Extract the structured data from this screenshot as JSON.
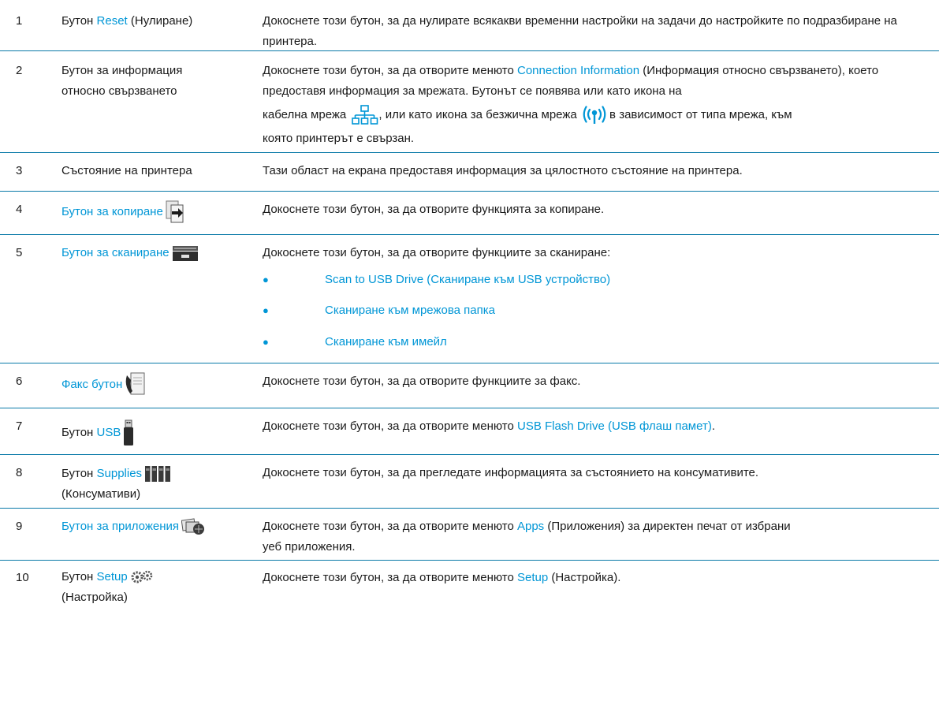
{
  "rows": [
    {
      "num": "1",
      "name": [
        "Бутон ",
        "Reset",
        " (Нулиране)"
      ],
      "desc": "Докоснете този бутон, за да нулирате всякакви временни настройки на задачи до настройките по подразбиране на принтера."
    },
    {
      "num": "2",
      "name": "Бутон за информация относно свързването",
      "desc_a": "Докоснете този бутон, за да отворите менюто ",
      "desc_link": "Connection Information",
      "desc_b": " (Информация относно свързването), което предоставя информация за мрежата. Бутонът се появява или като икона на",
      "desc_c": "кабелна мрежа ",
      "desc_d": ", или като икона за безжична мрежа ",
      "desc_e": " в зависимост от типа мрежа, към",
      "desc_f": "която принтерът е свързан.",
      "icons": [
        "wired-network-icon",
        "wireless-network-icon"
      ]
    },
    {
      "num": "3",
      "name": "Състояние на принтера",
      "desc": "Тази област на екрана предоставя информация за цялостното състояние на принтера."
    },
    {
      "num": "4",
      "name": "Бутон за копиране",
      "desc": "Докоснете този бутон, за да отворите функцията за копиране.",
      "icon": "copy-icon"
    },
    {
      "num": "5",
      "name": "Бутон за сканиране",
      "desc": "Докоснете този бутон, за да отворите функциите за сканиране:",
      "icon": "scanner-icon",
      "bullets": [
        "Scan to USB Drive (Сканиране към USB устройство)",
        "Сканиране към мрежова папка",
        "Сканиране към имейл"
      ]
    },
    {
      "num": "6",
      "name": "Факс бутон",
      "desc": "Докоснете този бутон, за да отворите функциите за факс.",
      "icon": "fax-icon"
    },
    {
      "num": "7",
      "name": [
        "Бутон ",
        "USB"
      ],
      "desc_a": "Докоснете този бутон, за да отворите менюто ",
      "desc_link": "USB Flash Drive (USB флаш памет)",
      "desc_b": ".",
      "icon": "usb-drive-icon"
    },
    {
      "num": "8",
      "name": [
        "Бутон ",
        "Supplies",
        "(Консумативи)"
      ],
      "desc": "Докоснете този бутон, за да прегледате информацията за състоянието на консумативите.",
      "icon": "supplies-icon"
    },
    {
      "num": "9",
      "name": "Бутон за приложения",
      "desc_a": "Докоснете този бутон, за да отворите менюто ",
      "desc_link": "Apps",
      "desc_b": " (Приложения) за директен печат от избрани",
      "desc_c": "уеб приложения.",
      "icon": "apps-icon"
    },
    {
      "num": "10",
      "name": [
        "Бутон ",
        "Setup",
        "(Настройка)"
      ],
      "desc_a": "Докоснете този бутон, за да отворите менюто ",
      "desc_link": "Setup",
      "desc_b": " (Настройка).",
      "icon": "setup-gears-icon"
    }
  ],
  "colors": {
    "link": "#0096d6",
    "rule": "#0a7aa8",
    "text": "#1a1a1a"
  }
}
